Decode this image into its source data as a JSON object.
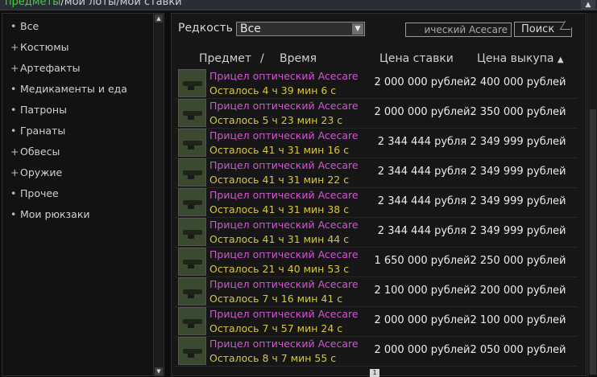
{
  "topbar": {
    "tabs": [
      {
        "label": "предметы",
        "active": true
      },
      {
        "label": "мои лоты",
        "active": false
      },
      {
        "label": "мои ставки",
        "active": false
      }
    ],
    "separator": "/"
  },
  "sidebar": {
    "items": [
      {
        "marker": "•",
        "label": "Все"
      },
      {
        "marker": "+",
        "label": "Костюмы"
      },
      {
        "marker": "+",
        "label": "Артефакты"
      },
      {
        "marker": "•",
        "label": "Медикаменты и еда"
      },
      {
        "marker": "•",
        "label": "Патроны"
      },
      {
        "marker": "•",
        "label": "Гранаты"
      },
      {
        "marker": "+",
        "label": "Обвесы"
      },
      {
        "marker": "+",
        "label": "Оружие"
      },
      {
        "marker": "•",
        "label": "Прочее"
      },
      {
        "marker": "•",
        "label": "Мои рюкзаки"
      }
    ]
  },
  "filter": {
    "rarity_label": "Редкость",
    "rarity_value": "Все",
    "search_value": "ический Acecare",
    "search_button": "Поиск"
  },
  "table": {
    "header_item": "Предмет",
    "header_sep": "/",
    "header_time": "Время",
    "header_bid": "Цена ставки",
    "header_buyout": "Цена выкупа",
    "sort_indicator": "▲",
    "rows": [
      {
        "name": "Прицел оптический Acecare",
        "time": "Осталось 4 ч 39 мин 6 с",
        "bid": "2 000 000 рублей",
        "buyout": "2 400 000 рублей"
      },
      {
        "name": "Прицел оптический Acecare",
        "time": "Осталось 5 ч 23 мин 23 с",
        "bid": "2 000 000 рублей",
        "buyout": "2 350 000 рублей"
      },
      {
        "name": "Прицел оптический Acecare",
        "time": "Осталось 41 ч 31 мин 16 с",
        "bid": "2 344 444 рубля",
        "buyout": "2 349 999 рублей"
      },
      {
        "name": "Прицел оптический Acecare",
        "time": "Осталось 41 ч 31 мин 22 с",
        "bid": "2 344 444 рубля",
        "buyout": "2 349 999 рублей"
      },
      {
        "name": "Прицел оптический Acecare",
        "time": "Осталось 41 ч 31 мин 38 с",
        "bid": "2 344 444 рубля",
        "buyout": "2 349 999 рублей"
      },
      {
        "name": "Прицел оптический Acecare",
        "time": "Осталось 41 ч 31 мин 44 с",
        "bid": "2 344 444 рубля",
        "buyout": "2 349 999 рублей"
      },
      {
        "name": "Прицел оптический Acecare",
        "time": "Осталось 21 ч 40 мин 53 с",
        "bid": "1 650 000 рублей",
        "buyout": "2 250 000 рублей"
      },
      {
        "name": "Прицел оптический Acecare",
        "time": "Осталось 7 ч 16 мин 41 с",
        "bid": "2 100 000 рублей",
        "buyout": "2 200 000 рублей"
      },
      {
        "name": "Прицел оптический Acecare",
        "time": "Осталось 7 ч 57 мин 24 с",
        "bid": "2 000 000 рублей",
        "buyout": "2 100 000 рублей"
      },
      {
        "name": "Прицел оптический Acecare",
        "time": "Осталось 8 ч 7 мин 55 с",
        "bid": "2 000 000 рублей",
        "buyout": "2 050 000 рублей"
      }
    ]
  },
  "pagination": {
    "current": "1"
  },
  "icons": {
    "dropdown": "chevron-down-icon",
    "item": "optical-scope-icon"
  }
}
